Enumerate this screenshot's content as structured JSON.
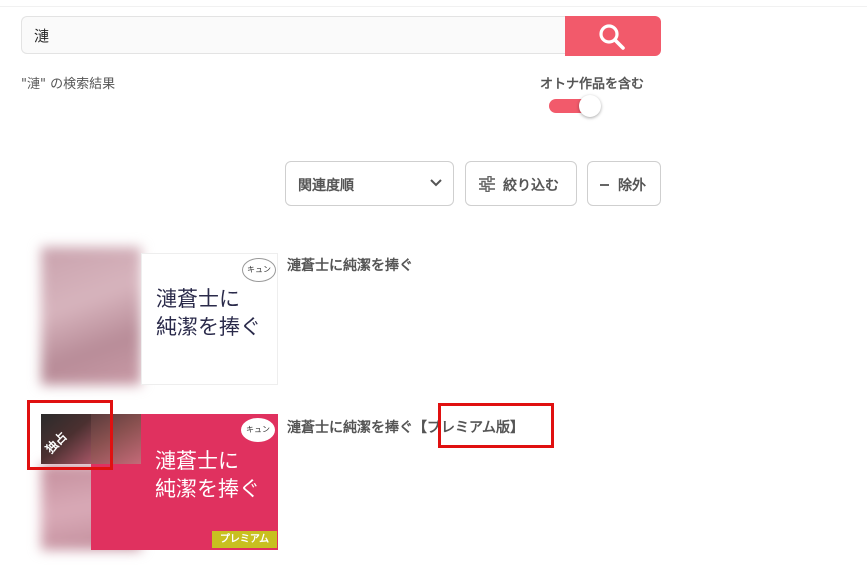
{
  "search": {
    "query": "漣",
    "result_label": "\"漣\" の検索結果"
  },
  "adult_toggle": {
    "label": "オトナ作品を含む",
    "on": true
  },
  "controls": {
    "sort_label": "関連度順",
    "filter_label": "絞り込む",
    "exclude_label": "除外"
  },
  "results": [
    {
      "title": "漣蒼士に純潔を捧ぐ",
      "cover_title_line1": "漣蒼士に",
      "cover_title_line2": "純潔を捧ぐ",
      "label_badge": "キュン"
    },
    {
      "title": "漣蒼士に純潔を捧ぐ【プレミアム版】",
      "cover_title_line1": "漣蒼士に",
      "cover_title_line2": "純潔を捧ぐ",
      "label_badge": "キュン",
      "exclusive_badge": "独占",
      "premium_tag": "プレミアム"
    }
  ],
  "colors": {
    "accent": "#f25a6b",
    "highlight_box": "#e01010",
    "premium_tag": "#c8c020"
  }
}
